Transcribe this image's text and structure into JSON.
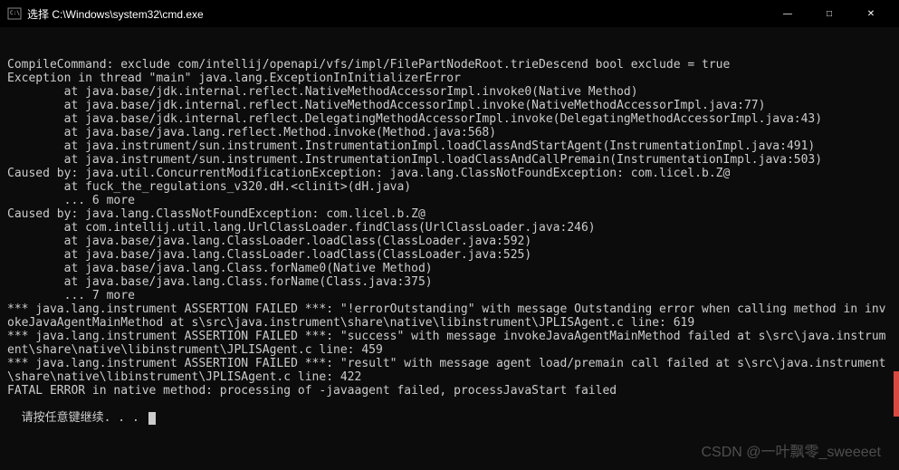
{
  "titlebar": {
    "icon_name": "cmd-icon",
    "title": "选择 C:\\Windows\\system32\\cmd.exe",
    "minimize": "—",
    "maximize": "□",
    "close": "✕"
  },
  "terminal": {
    "lines": [
      "CompileCommand: exclude com/intellij/openapi/vfs/impl/FilePartNodeRoot.trieDescend bool exclude = true",
      "Exception in thread \"main\" java.lang.ExceptionInInitializerError",
      "        at java.base/jdk.internal.reflect.NativeMethodAccessorImpl.invoke0(Native Method)",
      "        at java.base/jdk.internal.reflect.NativeMethodAccessorImpl.invoke(NativeMethodAccessorImpl.java:77)",
      "        at java.base/jdk.internal.reflect.DelegatingMethodAccessorImpl.invoke(DelegatingMethodAccessorImpl.java:43)",
      "        at java.base/java.lang.reflect.Method.invoke(Method.java:568)",
      "        at java.instrument/sun.instrument.InstrumentationImpl.loadClassAndStartAgent(InstrumentationImpl.java:491)",
      "        at java.instrument/sun.instrument.InstrumentationImpl.loadClassAndCallPremain(InstrumentationImpl.java:503)",
      "Caused by: java.util.ConcurrentModificationException: java.lang.ClassNotFoundException: com.licel.b.Z@",
      "        at fuck_the_regulations_v320.dH.<clinit>(dH.java)",
      "        ... 6 more",
      "Caused by: java.lang.ClassNotFoundException: com.licel.b.Z@",
      "        at com.intellij.util.lang.UrlClassLoader.findClass(UrlClassLoader.java:246)",
      "        at java.base/java.lang.ClassLoader.loadClass(ClassLoader.java:592)",
      "        at java.base/java.lang.ClassLoader.loadClass(ClassLoader.java:525)",
      "        at java.base/java.lang.Class.forName0(Native Method)",
      "        at java.base/java.lang.Class.forName(Class.java:375)",
      "        ... 7 more",
      "*** java.lang.instrument ASSERTION FAILED ***: \"!errorOutstanding\" with message Outstanding error when calling method in invokeJavaAgentMainMethod at s\\src\\java.instrument\\share\\native\\libinstrument\\JPLISAgent.c line: 619",
      "*** java.lang.instrument ASSERTION FAILED ***: \"success\" with message invokeJavaAgentMainMethod failed at s\\src\\java.instrument\\share\\native\\libinstrument\\JPLISAgent.c line: 459",
      "*** java.lang.instrument ASSERTION FAILED ***: \"result\" with message agent load/premain call failed at s\\src\\java.instrument\\share\\native\\libinstrument\\JPLISAgent.c line: 422",
      "FATAL ERROR in native method: processing of -javaagent failed, processJavaStart failed"
    ],
    "prompt": "请按任意键继续. . . "
  },
  "watermark": "CSDN @一叶飘零_sweeeet"
}
